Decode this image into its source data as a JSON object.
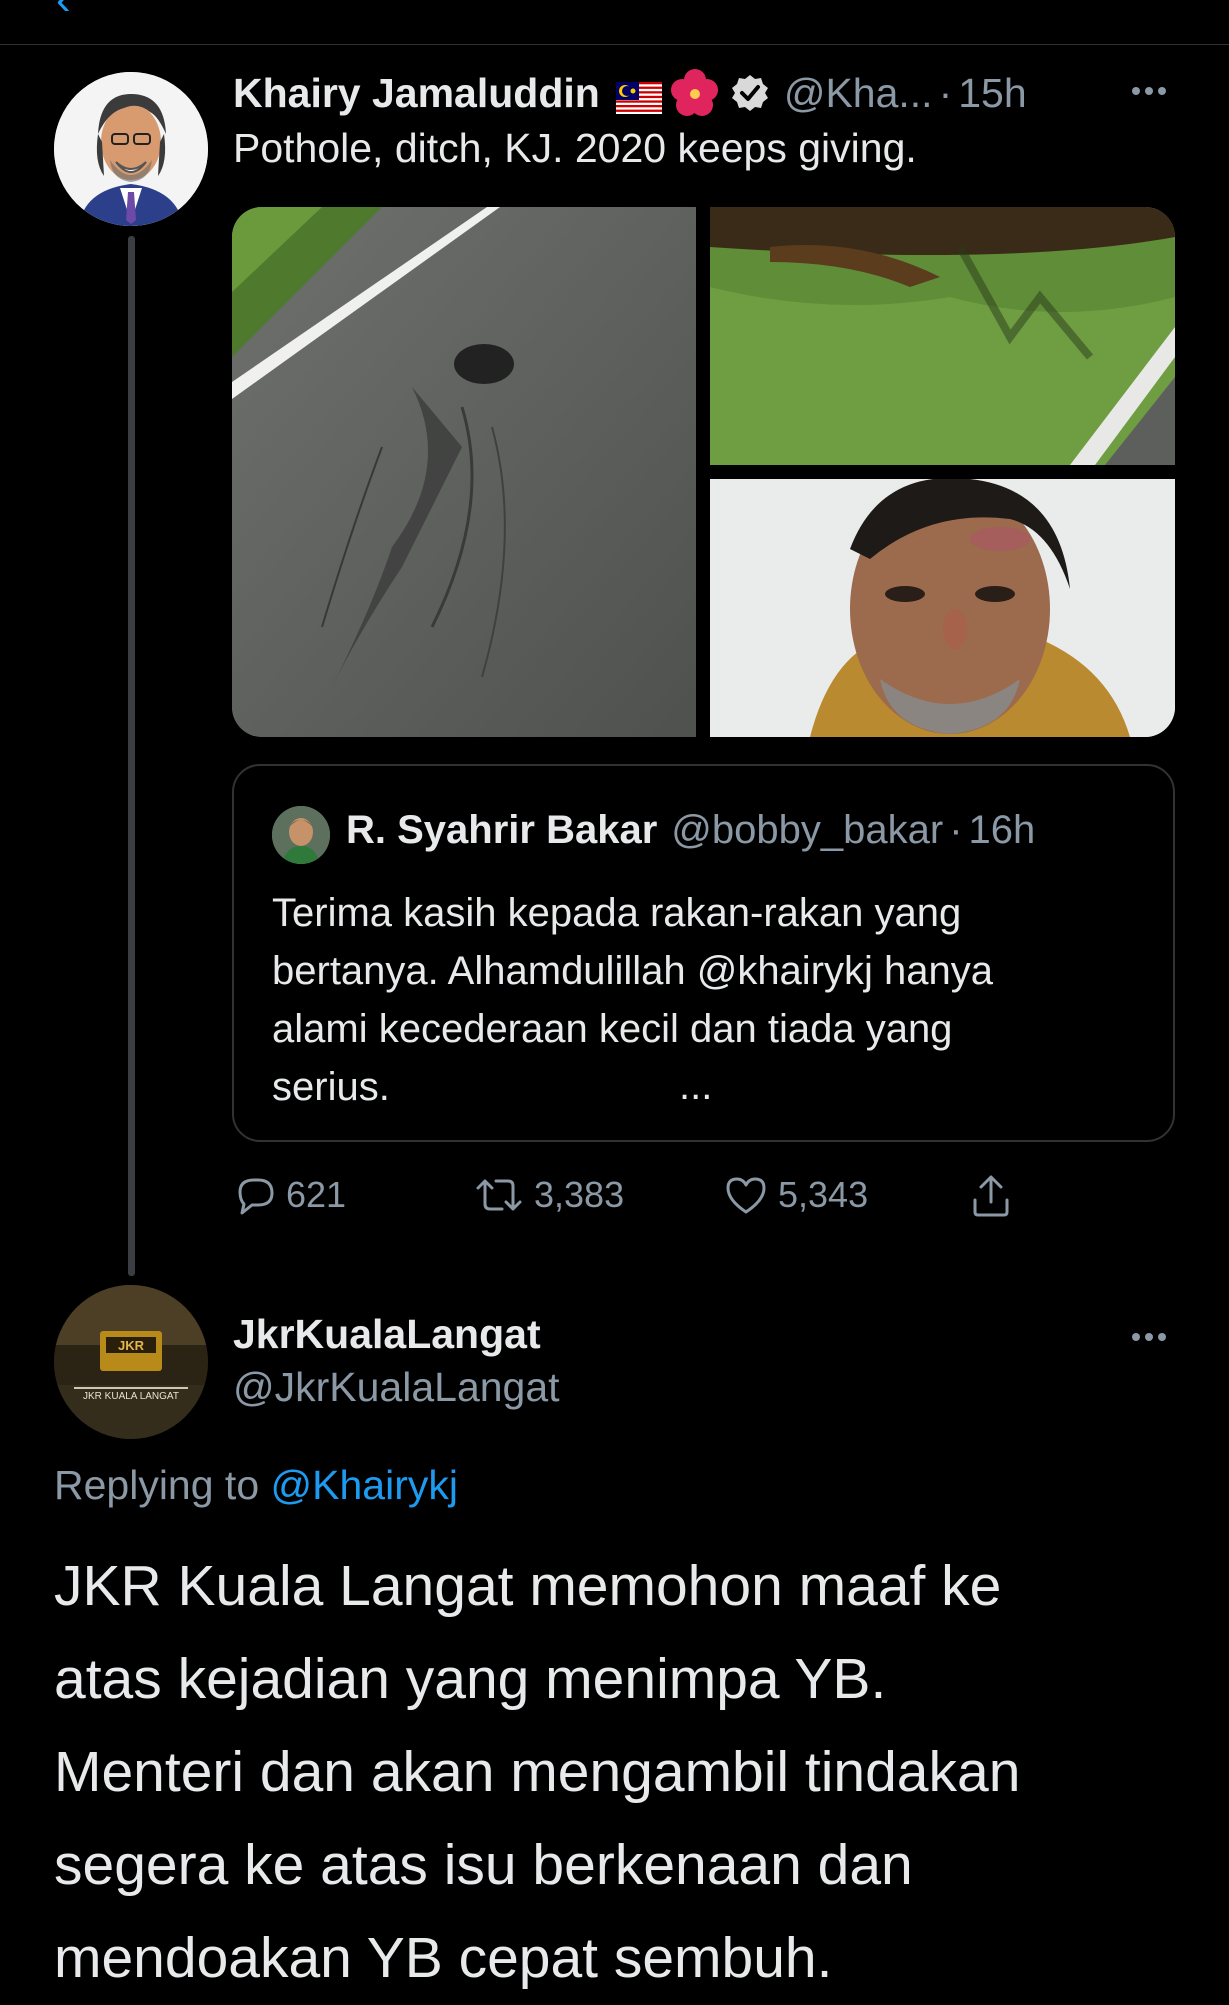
{
  "tweet": {
    "author_name": "Khairy Jamaluddin",
    "author_handle": "@Kha...",
    "time": "15h",
    "dot": "·",
    "text": "Pothole, ditch, KJ. 2020 keeps giving.",
    "media": [
      {
        "subject": "pothole-road-photo"
      },
      {
        "subject": "grass-ditch-photo"
      },
      {
        "subject": "injured-face-photo"
      }
    ]
  },
  "quote": {
    "author_name": "R. Syahrir Bakar",
    "author_handle": "@bobby_bakar",
    "dot": "·",
    "time": "16h",
    "lines": [
      "Terima kasih kepada rakan-rakan yang",
      "bertanya. Alhamdulillah @khairykj hanya",
      "alami kecederaan kecil dan tiada yang",
      "serius."
    ],
    "ellipsis": "..."
  },
  "actions": {
    "replies": "621",
    "retweets": "3,383",
    "likes": "5,343"
  },
  "reply": {
    "author_name": "JkrKualaLangat",
    "author_handle": "@JkrKualaLangat",
    "replying_prefix": "Replying to",
    "replying_to": "@Khairykj",
    "body_lines": [
      "JKR Kuala Langat memohon maaf ke",
      "atas kejadian yang menimpa YB.",
      "Menteri dan akan mengambil tindakan",
      "segera ke atas isu berkenaan dan",
      "mendoakan YB cepat sembuh."
    ],
    "logo_text": "JKR",
    "logo_caption": "JKR KUALA LANGAT"
  },
  "colors": {
    "background": "#000000",
    "accent": "#1d9bf0",
    "secondary_text": "#8b98a5",
    "primary_text": "#e7e9ea",
    "divider": "#2f3336"
  }
}
